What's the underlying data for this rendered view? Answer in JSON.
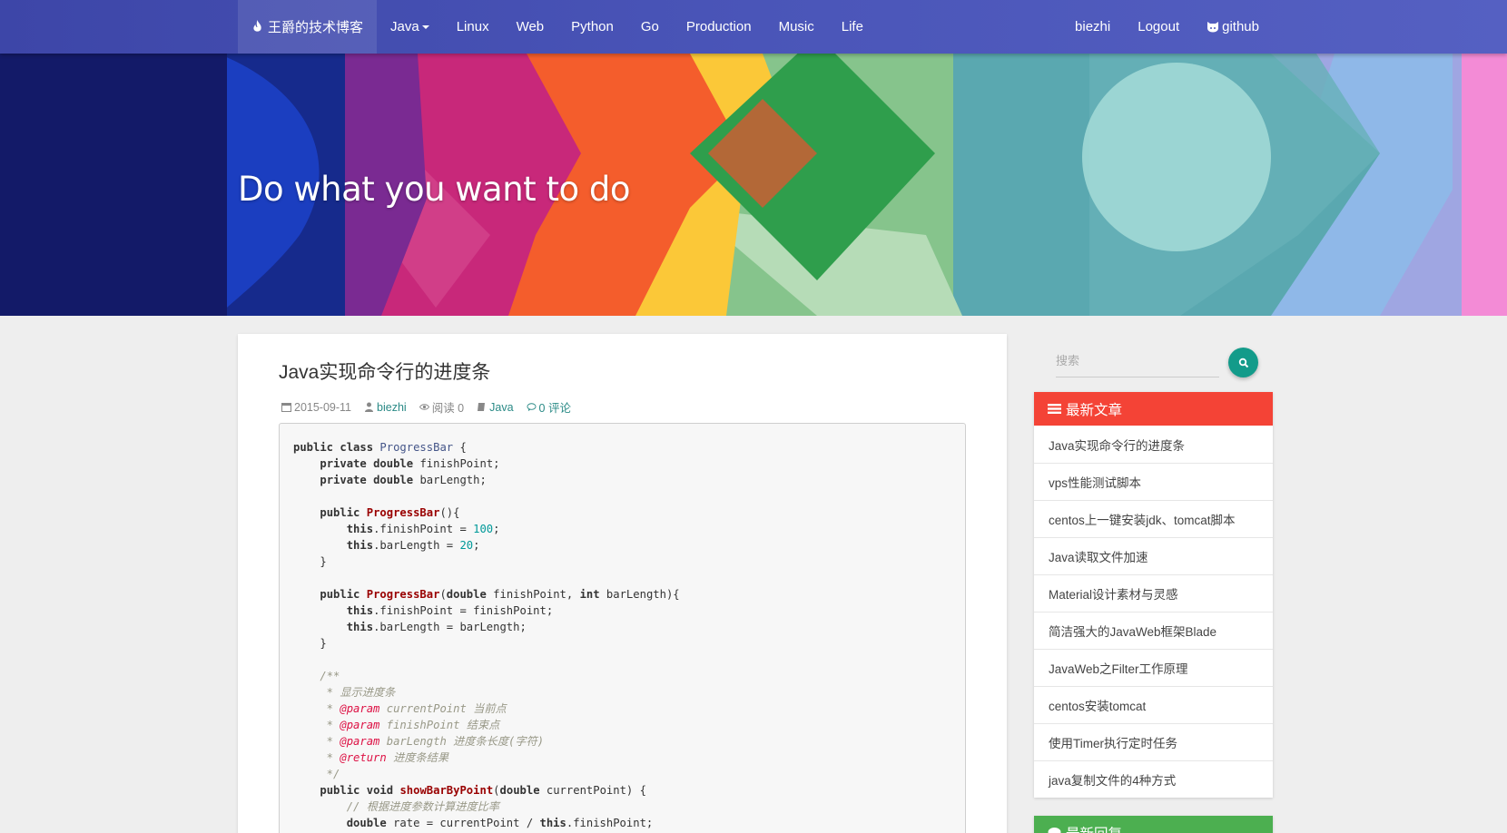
{
  "navbar": {
    "brand": "王爵的技术博客",
    "links": [
      "Java",
      "Linux",
      "Web",
      "Python",
      "Go",
      "Production",
      "Music",
      "Life"
    ],
    "right_links": [
      "biezhi",
      "Logout",
      "github"
    ]
  },
  "hero": {
    "title": "Do what you want to do"
  },
  "post": {
    "title": "Java实现命令行的进度条",
    "date": "2015-09-11",
    "author": "biezhi",
    "reads": "阅读 0",
    "category": "Java",
    "comments": "0 评论"
  },
  "sidebar": {
    "search_placeholder": "搜索",
    "recent_title": "最新文章",
    "recent_items": [
      "Java实现命令行的进度条",
      "vps性能测试脚本",
      "centos上一键安装jdk、tomcat脚本",
      "Java读取文件加速",
      "Material设计素材与灵感",
      "简洁强大的JavaWeb框架Blade",
      "JavaWeb之Filter工作原理",
      "centos安装tomcat",
      "使用Timer执行定时任务",
      "java复制文件的4种方式"
    ],
    "replies_title": "最新回复"
  },
  "colors": {
    "navbar": "#4a55b8",
    "accent": "#2a8a86",
    "recent_header": "#f44336",
    "replies_header": "#4caf50",
    "search_button": "#139b8a"
  }
}
